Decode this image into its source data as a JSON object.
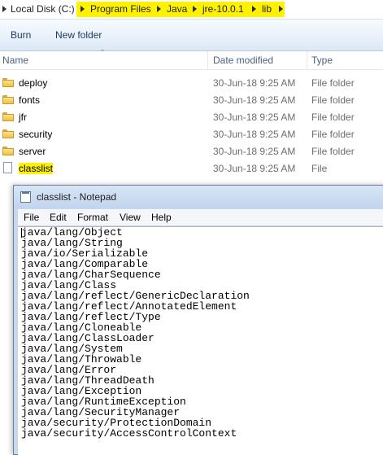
{
  "address": {
    "root": "Local Disk (C:)",
    "crumbs": [
      "Program Files",
      "Java",
      "jre-10.0.1",
      "lib"
    ]
  },
  "toolbar": {
    "burn": "Burn",
    "new_folder": "New folder"
  },
  "columns": {
    "name": "Name",
    "date": "Date modified",
    "type": "Type"
  },
  "files": [
    {
      "name": "deploy",
      "date": "30-Jun-18 9:25 AM",
      "type": "File folder",
      "kind": "folder"
    },
    {
      "name": "fonts",
      "date": "30-Jun-18 9:25 AM",
      "type": "File folder",
      "kind": "folder"
    },
    {
      "name": "jfr",
      "date": "30-Jun-18 9:25 AM",
      "type": "File folder",
      "kind": "folder"
    },
    {
      "name": "security",
      "date": "30-Jun-18 9:25 AM",
      "type": "File folder",
      "kind": "folder"
    },
    {
      "name": "server",
      "date": "30-Jun-18 9:25 AM",
      "type": "File folder",
      "kind": "folder"
    },
    {
      "name": "classlist",
      "date": "30-Jun-18 9:25 AM",
      "type": "File",
      "kind": "file"
    }
  ],
  "notepad": {
    "title": "classlist - Notepad",
    "menu": [
      "File",
      "Edit",
      "Format",
      "View",
      "Help"
    ],
    "lines": [
      "java/lang/Object",
      "java/lang/String",
      "java/io/Serializable",
      "java/lang/Comparable",
      "java/lang/CharSequence",
      "java/lang/Class",
      "java/lang/reflect/GenericDeclaration",
      "java/lang/reflect/AnnotatedElement",
      "java/lang/reflect/Type",
      "java/lang/Cloneable",
      "java/lang/ClassLoader",
      "java/lang/System",
      "java/lang/Throwable",
      "java/lang/Error",
      "java/lang/ThreadDeath",
      "java/lang/Exception",
      "java/lang/RuntimeException",
      "java/lang/SecurityManager",
      "java/security/ProtectionDomain",
      "java/security/AccessControlContext"
    ]
  },
  "colors": {
    "highlight": "#fff200",
    "accent": "#1e395b"
  }
}
